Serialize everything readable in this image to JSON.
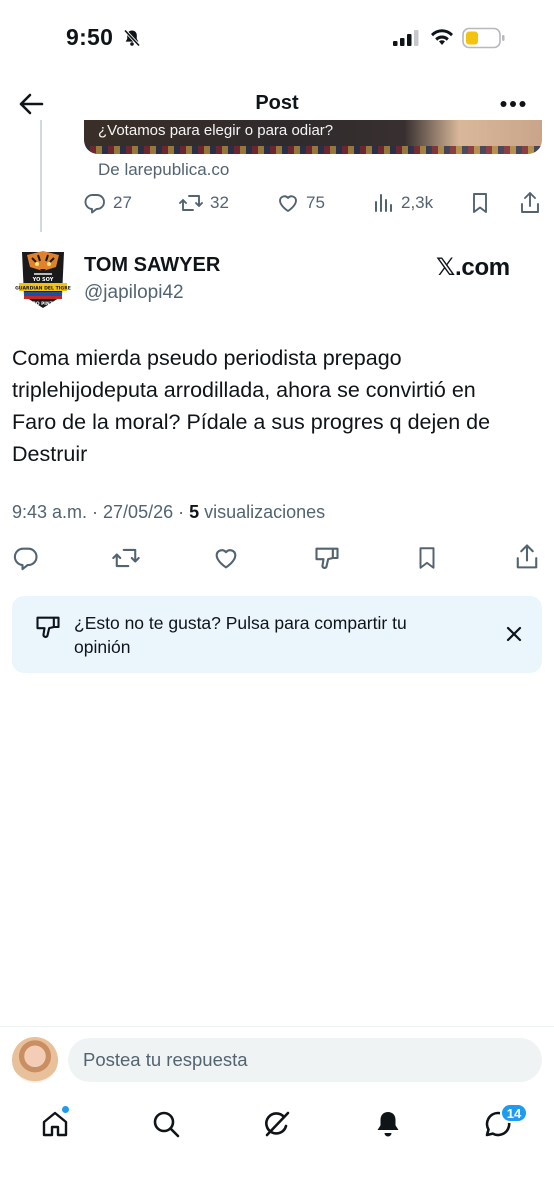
{
  "status_bar": {
    "time": "9:50",
    "icons": [
      "bell-slash-icon",
      "signal-icon",
      "wifi-icon",
      "battery-icon"
    ]
  },
  "header": {
    "title": "Post",
    "back_icon": "arrow-left-icon",
    "more_icon": "more-icon"
  },
  "quoted_post": {
    "headline": "¿Votamos para elegir o para odiar?",
    "source": "De larepublica.co",
    "metrics": {
      "replies": "27",
      "reposts": "32",
      "likes": "75",
      "views": "2,3k"
    }
  },
  "post": {
    "author_name": "TOM SAWYER",
    "author_handle": "@japilopi42",
    "avatar_text": {
      "line1": "YO SOY",
      "line2": "GUARDIAN DEL TIGRE",
      "line3": "JAIRO PINZON"
    },
    "brand": "𝕏.com",
    "text_lines": [
      "Coma mierda pseudo periodista prepago",
      "triplehijodeputa arrodillada, ahora se convirtió en",
      "Faro de la moral? Pídale a sus progres q dejen de",
      "Destruir"
    ],
    "timestamp": "9:43 a.m. · 27/05/26 · ",
    "views_count": "5",
    "views_label": " visualizaciones"
  },
  "feedback_banner": {
    "text": "¿Esto no te gusta? Pulsa para compartir tu opinión"
  },
  "reply": {
    "placeholder": "Postea tu respuesta"
  },
  "bottom_nav": {
    "items": [
      "home-icon",
      "search-icon",
      "grok-icon",
      "notifications-icon",
      "messages-icon"
    ],
    "messages_badge": "14"
  },
  "colors": {
    "accent": "#1d9bf0",
    "text": "#0f1419",
    "secondary": "#536471",
    "banner_bg": "#eaf6fc"
  }
}
